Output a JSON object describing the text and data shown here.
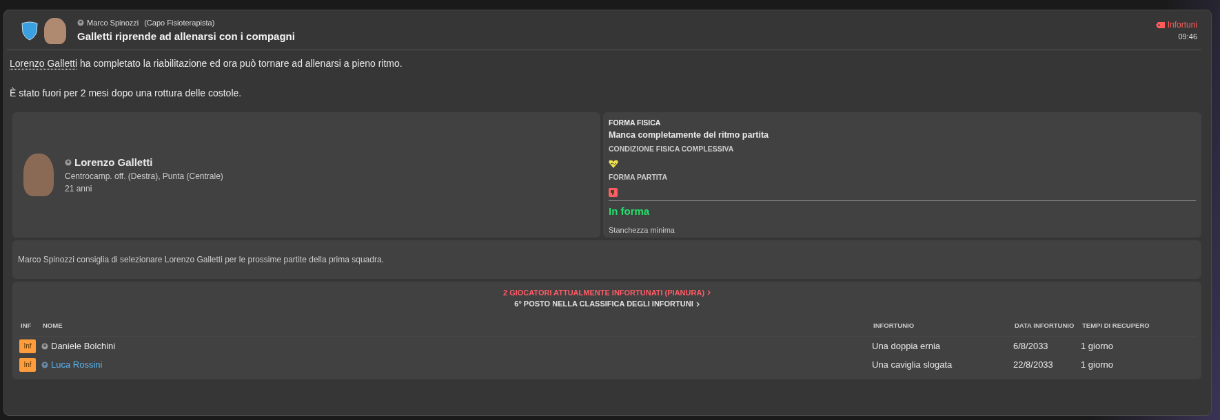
{
  "header": {
    "author": "Marco Spinozzi",
    "author_role": "(Capo Fisioterapista)",
    "title": "Galletti riprende ad allenarsi con i compagni",
    "category": "Infortuni",
    "time": "09:46"
  },
  "body": {
    "player_link": "Lorenzo Galletti",
    "line_1_rest": "ha completato la riabilitazione ed ora può tornare ad allenarsi a pieno ritmo.",
    "line_2": "È stato fuori per 2 mesi dopo una rottura delle costole."
  },
  "player": {
    "name": "Lorenzo Galletti",
    "positions": "Centrocamp. off. (Destra), Punta (Centrale)",
    "age": "21 anni"
  },
  "fitness": {
    "heading": "FORMA FISICA",
    "summary": "Manca completamente del ritmo partita",
    "condition_label": "CONDIZIONE FISICA COMPLESSIVA",
    "match_fitness_label": "FORMA PARTITA",
    "status": "In forma",
    "fatigue": "Stanchezza minima"
  },
  "advice": "Marco Spinozzi consiglia di selezionare Lorenzo Galletti per le prossime partite della prima squadra.",
  "injuries": {
    "summary_link": "2 GIOCATORI ATTUALMENTE INFORTUNATI (PIANURA)",
    "ranking_link": "6° POSTO NELLA CLASSIFICA DEGLI INFORTUNI",
    "columns": [
      "INF",
      "NOME",
      "INFORTUNIO",
      "DATA INFORTUNIO",
      "TEMPI DI RECUPERO"
    ],
    "rows": [
      {
        "badge": "Inf",
        "name": "Daniele Bolchini",
        "highlighted": false,
        "injury": "Una doppia ernia",
        "date": "6/8/2033",
        "recovery": "1 giorno"
      },
      {
        "badge": "Inf",
        "name": "Luca Rossini",
        "highlighted": true,
        "injury": "Una caviglia slogata",
        "date": "22/8/2033",
        "recovery": "1 giorno"
      }
    ]
  }
}
